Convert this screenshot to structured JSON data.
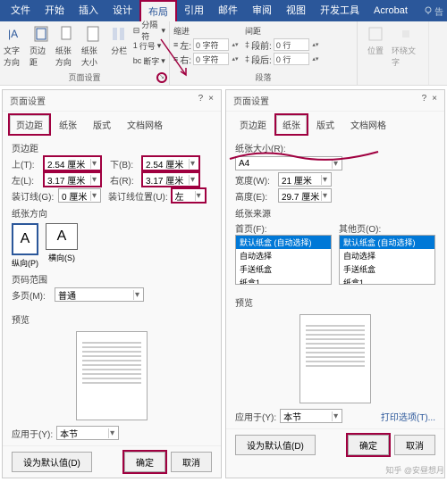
{
  "tabs": {
    "file": "文件",
    "home": "开始",
    "insert": "插入",
    "design": "设计",
    "layout": "布局",
    "ref": "引用",
    "mail": "邮件",
    "review": "审阅",
    "view": "视图",
    "dev": "开发工具",
    "acrobat": "Acrobat",
    "tell": "告"
  },
  "ribbon": {
    "textdir": "文字方向",
    "margins": "页边距",
    "orient": "纸张方向",
    "size": "纸张大小",
    "columns": "分栏",
    "breaks": "分隔符",
    "lineno": "行号",
    "hyphen": "断字",
    "group_page": "页面设置",
    "group_para": "段落",
    "indent": "缩进",
    "spacing": "间距",
    "left": "左:",
    "right": "右:",
    "before": "段前:",
    "after": "段后:",
    "val_indent": "0 字符",
    "val_space": "0 行",
    "pos": "位置",
    "wrap": "环绕文字"
  },
  "dlg": {
    "title": "页面设置",
    "tabs": {
      "margin": "页边距",
      "paper": "纸张",
      "layout": "版式",
      "grid": "文档网格"
    },
    "margins_section": "页边距",
    "top": "上(T):",
    "bottom": "下(B):",
    "left": "左(L):",
    "right": "右(R):",
    "gutter": "装订线(G):",
    "gutterpos": "装订线位置(U):",
    "gutterpos_val": "左",
    "val_tb": "2.54 厘米",
    "val_lr": "3.17 厘米",
    "val_g": "0 厘米",
    "orient_section": "纸张方向",
    "portrait": "纵向(P)",
    "landscape": "横向(S)",
    "range_section": "页码范围",
    "multi": "多页(M):",
    "multi_val": "普通",
    "preview": "预览",
    "apply": "应用于(Y):",
    "apply_val": "本节",
    "default": "设为默认值(D)",
    "ok": "确定",
    "cancel": "取消",
    "papersize_section": "纸张大小(R):",
    "paper_val": "A4",
    "width": "宽度(W):",
    "height": "高度(E):",
    "wval": "21 厘米",
    "hval": "29.7 厘米",
    "source_section": "纸张来源",
    "first": "首页(F):",
    "other": "其他页(O):",
    "tray_default": "默认纸盒 (自动选择)",
    "tray_auto": "自动选择",
    "tray_manual": "手送纸盒",
    "tray_1": "纸盒1",
    "printopt": "打印选项(T)..."
  },
  "watermark": "知乎 @安昼想月"
}
